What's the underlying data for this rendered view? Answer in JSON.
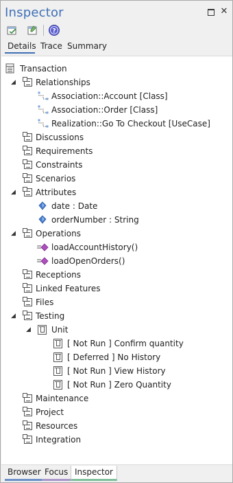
{
  "window": {
    "title": "Inspector",
    "restore_icon": "restore-icon",
    "close_glyph": "✕"
  },
  "toolbar": {
    "buttons": [
      {
        "icon": "element-properties-icon"
      },
      {
        "icon": "feature-properties-icon"
      },
      {
        "icon": "help-icon"
      }
    ]
  },
  "tabs": {
    "details": "Details",
    "trace": "Trace",
    "summary": "Summary",
    "active": "Details"
  },
  "tree": {
    "root": "Transaction",
    "relationships": {
      "label": "Relationships",
      "items": [
        "Association::Account [Class]",
        "Association::Order [Class]",
        "Realization::Go To Checkout [UseCase]"
      ]
    },
    "discussions": "Discussions",
    "requirements": "Requirements",
    "constraints": "Constraints",
    "scenarios": "Scenarios",
    "attributes": {
      "label": "Attributes",
      "items": [
        "date : Date",
        "orderNumber : String"
      ]
    },
    "operations": {
      "label": "Operations",
      "items": [
        "loadAccountHistory()",
        "loadOpenOrders()"
      ]
    },
    "receptions": "Receptions",
    "linked_features": "Linked Features",
    "files": "Files",
    "testing": {
      "label": "Testing",
      "unit": {
        "label": "Unit",
        "items": [
          "[ Not Run ] Confirm quantity",
          "[ Deferred ] No History",
          "[ Not Run ] View History",
          "[ Not Run ] Zero Quantity"
        ]
      }
    },
    "maintenance": "Maintenance",
    "project": "Project",
    "resources": "Resources",
    "integration": "Integration"
  },
  "bottom_tabs": {
    "browser": "Browser",
    "focus": "Focus",
    "inspector": "Inspector",
    "active": "Inspector"
  },
  "colors": {
    "title": "#3d6fb5",
    "attribute_icon": "#4a7fd1",
    "operation_icon": "#b04fc0",
    "browser_tab": "#6b8fc9",
    "focus_tab": "#a995c9",
    "inspector_tab": "#7fbf9a"
  }
}
